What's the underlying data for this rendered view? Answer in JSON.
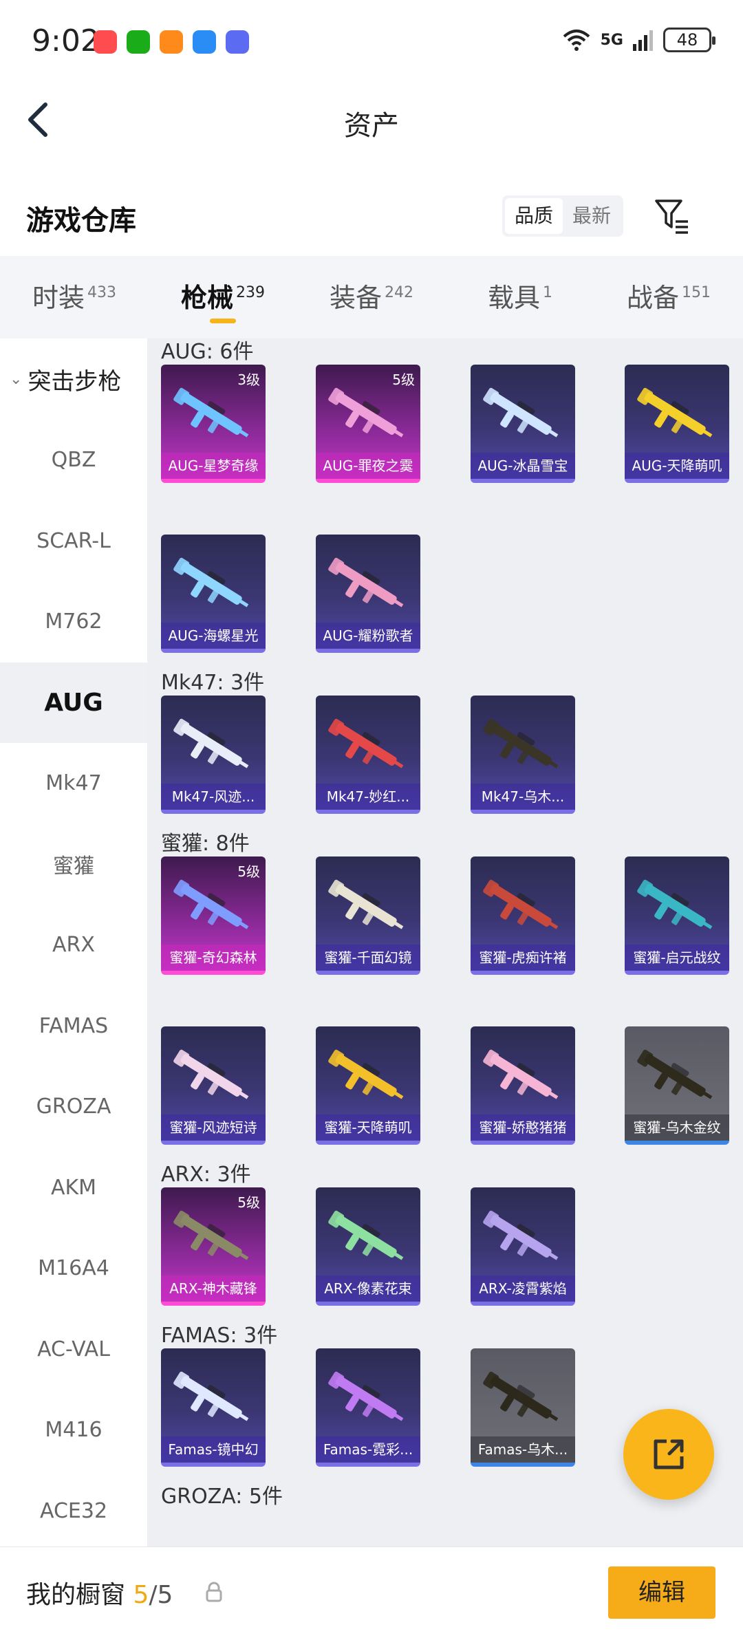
{
  "status": {
    "time": "9:02",
    "network": "5G",
    "battery": "48",
    "app_icons": [
      {
        "icon": "shopping-bag-icon",
        "color": "#ff4d4f"
      },
      {
        "icon": "wechat-icon",
        "color": "#1aad19"
      },
      {
        "icon": "game-center-icon",
        "color": "#ff8a1c"
      },
      {
        "icon": "browser-icon",
        "color": "#2a8cf5"
      },
      {
        "icon": "music-icon",
        "color": "#5b6cf2"
      }
    ]
  },
  "header": {
    "title": "资产"
  },
  "section": {
    "title": "游戏仓库",
    "sort_options": [
      "品质",
      "最新"
    ]
  },
  "tabs": [
    {
      "label": "时装",
      "count": "433"
    },
    {
      "label": "枪械",
      "count": "239"
    },
    {
      "label": "装备",
      "count": "242"
    },
    {
      "label": "载具",
      "count": "1"
    },
    {
      "label": "战备",
      "count": "151"
    }
  ],
  "sidebar": {
    "group": "突击步枪",
    "items": [
      "QBZ",
      "SCAR-L",
      "M762",
      "AUG",
      "Mk47",
      "蜜獾",
      "ARX",
      "FAMAS",
      "GROZA",
      "AKM",
      "M16A4",
      "AC-VAL",
      "M416",
      "ACE32"
    ],
    "active": "AUG"
  },
  "groups": [
    {
      "title": "AUG: 6件",
      "items": [
        {
          "label": "AUG-星梦奇缘",
          "badge": "3级",
          "quality": "q5",
          "gun": "#6fc3ff"
        },
        {
          "label": "AUG-罪夜之霙",
          "badge": "5级",
          "quality": "q5",
          "gun": "#f0a0d8"
        },
        {
          "label": "AUG-冰晶雪宝",
          "badge": "",
          "quality": "q4",
          "gun": "#cfe4ff"
        },
        {
          "label": "AUG-天降萌叽",
          "badge": "",
          "quality": "q4",
          "gun": "#f6d02a"
        },
        {
          "label": "AUG-海螺星光",
          "badge": "",
          "quality": "q4",
          "gun": "#8fd6ff"
        },
        {
          "label": "AUG-耀粉歌者",
          "badge": "",
          "quality": "q4",
          "gun": "#ef9cc4"
        }
      ]
    },
    {
      "title": "Mk47: 3件",
      "items": [
        {
          "label": "Mk47-风迹...",
          "badge": "",
          "quality": "q4",
          "gun": "#e8eef8"
        },
        {
          "label": "Mk47-妙红...",
          "badge": "",
          "quality": "q4",
          "gun": "#e54848"
        },
        {
          "label": "Mk47-乌木...",
          "badge": "",
          "quality": "q4",
          "gun": "#3a3526"
        }
      ]
    },
    {
      "title": "蜜獾: 8件",
      "items": [
        {
          "label": "蜜獾-奇幻森林",
          "badge": "5级",
          "quality": "q5",
          "gun": "#7f9cff"
        },
        {
          "label": "蜜獾-千面幻镜",
          "badge": "",
          "quality": "q4",
          "gun": "#e8e3d2"
        },
        {
          "label": "蜜獾-虎痴许褚",
          "badge": "",
          "quality": "q4",
          "gun": "#c94a3b"
        },
        {
          "label": "蜜獾-启元战纹",
          "badge": "",
          "quality": "q4",
          "gun": "#3ab7c4"
        },
        {
          "label": "蜜獾-风迹短诗",
          "badge": "",
          "quality": "q4",
          "gun": "#f1d5ea"
        },
        {
          "label": "蜜獾-天降萌叽",
          "badge": "",
          "quality": "q4",
          "gun": "#f3c02b"
        },
        {
          "label": "蜜獾-娇憨猪猪",
          "badge": "",
          "quality": "q4",
          "gun": "#f6b5d4"
        },
        {
          "label": "蜜獾-乌木金纹",
          "badge": "",
          "quality": "grey",
          "gun": "#2e2a1c"
        }
      ]
    },
    {
      "title": "ARX: 3件",
      "items": [
        {
          "label": "ARX-神木藏锋",
          "badge": "5级",
          "quality": "q5",
          "gun": "#8b8a66"
        },
        {
          "label": "ARX-像素花束",
          "badge": "",
          "quality": "q4",
          "gun": "#8ee0a0"
        },
        {
          "label": "ARX-凌霄紫焰",
          "badge": "",
          "quality": "q4",
          "gun": "#b6a4ee"
        }
      ]
    },
    {
      "title": "FAMAS: 3件",
      "items": [
        {
          "label": "Famas-镜中幻",
          "badge": "",
          "quality": "q4",
          "gun": "#dfe8ff"
        },
        {
          "label": "Famas-霓彩...",
          "badge": "",
          "quality": "q4",
          "gun": "#c07bf2"
        },
        {
          "label": "Famas-乌木...",
          "badge": "",
          "quality": "grey",
          "gun": "#2c281b"
        }
      ]
    },
    {
      "title": "GROZA: 5件",
      "items": []
    }
  ],
  "bottom": {
    "label": "我的橱窗",
    "count": "5",
    "separator": "/",
    "total": "5",
    "edit_label": "编辑"
  },
  "colors": {
    "accent": "#f6ac19"
  }
}
